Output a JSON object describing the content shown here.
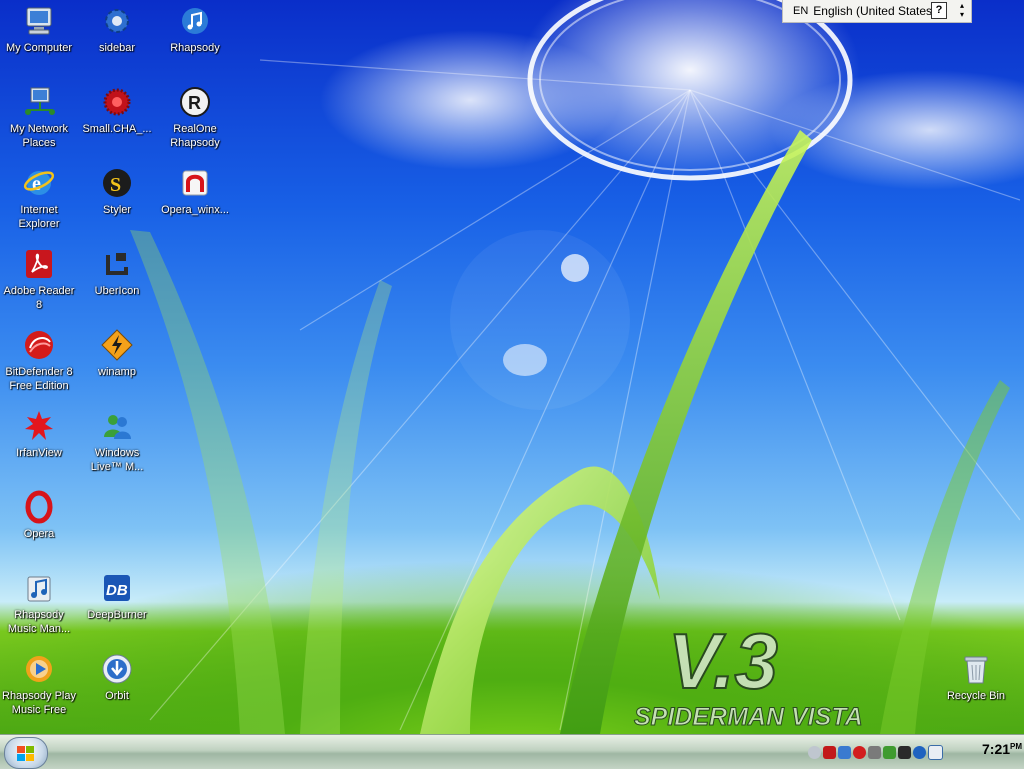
{
  "desktop": {
    "icons": [
      {
        "label": "My Computer",
        "icon": "computer-icon"
      },
      {
        "label": "My Network\nPlaces",
        "icon": "network-places-icon"
      },
      {
        "label": "Internet\nExplorer",
        "icon": "internet-explorer-icon"
      },
      {
        "label": "Adobe Reader\n8",
        "icon": "adobe-reader-icon"
      },
      {
        "label": "BitDefender 8\nFree Edition",
        "icon": "bitdefender-icon"
      },
      {
        "label": "IrfanView",
        "icon": "irfanview-icon"
      },
      {
        "label": "Opera",
        "icon": "opera-icon"
      },
      {
        "label": "Rhapsody\nMusic Man...",
        "icon": "rhapsody-music-manager-icon"
      },
      {
        "label": "Rhapsody Play\nMusic Free",
        "icon": "rhapsody-play-icon"
      },
      {
        "label": "sidebar",
        "icon": "gear-icon"
      },
      {
        "label": "Small.CHA_...",
        "icon": "small-cha-icon"
      },
      {
        "label": "Styler",
        "icon": "styler-icon"
      },
      {
        "label": "UberIcon",
        "icon": "ubericon-icon"
      },
      {
        "label": "winamp",
        "icon": "winamp-icon"
      },
      {
        "label": "Windows\nLive™ M...",
        "icon": "windows-live-messenger-icon"
      },
      {
        "label": "DeepBurner",
        "icon": "deepburner-icon"
      },
      {
        "label": "Orbit",
        "icon": "orbit-icon"
      },
      {
        "label": "Rhapsody",
        "icon": "rhapsody-icon"
      },
      {
        "label": "RealOne\nRhapsody",
        "icon": "realone-rhapsody-icon"
      },
      {
        "label": "Opera_winx...",
        "icon": "opera-winx-icon"
      },
      {
        "label": "Recycle Bin",
        "icon": "recycle-bin-icon"
      }
    ],
    "wallpaper": {
      "title": "V.3",
      "subtitle": "SPIDERMAN VISTA"
    }
  },
  "language_bar": {
    "code": "EN",
    "language": "English (United States)",
    "help": "?"
  },
  "taskbar": {
    "clock": "7:21",
    "clock_suffix": "PM",
    "tray_icons": [
      "tray-icon-1",
      "tray-icon-2",
      "tray-icon-3",
      "tray-icon-4",
      "tray-icon-5",
      "tray-icon-6",
      "tray-icon-7",
      "tray-icon-8",
      "tray-icon-9"
    ]
  },
  "colors": {
    "sky_top": "#0a2ec9",
    "sky_mid": "#3b8cf0",
    "grass": "#4ca614",
    "taskbar": "#bfd1c0"
  }
}
